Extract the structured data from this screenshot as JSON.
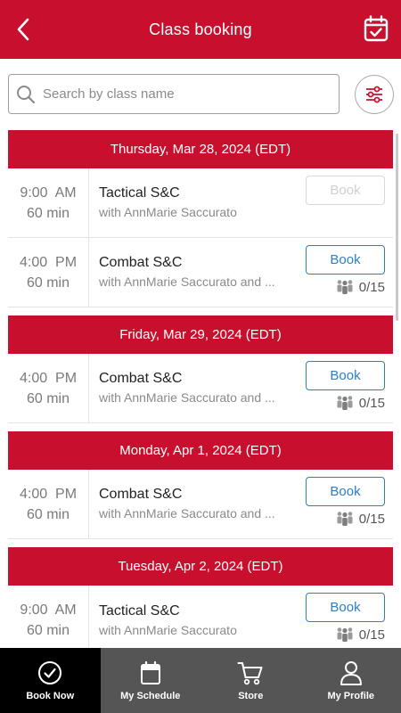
{
  "header": {
    "title": "Class booking"
  },
  "search": {
    "placeholder": "Search by class name"
  },
  "days": [
    {
      "date": "Thursday, Mar 28, 2024 (EDT)",
      "classes": [
        {
          "time": "9:00  AM",
          "duration": "60 min",
          "name": "Tactical S&C",
          "instructor": "with AnnMarie Saccurato",
          "book_label": "Book",
          "book_enabled": false,
          "capacity": ""
        },
        {
          "time": "4:00  PM",
          "duration": "60 min",
          "name": "Combat S&C",
          "instructor": "with AnnMarie Saccurato and ...",
          "book_label": "Book",
          "book_enabled": true,
          "capacity": "0/15"
        }
      ]
    },
    {
      "date": "Friday, Mar 29, 2024 (EDT)",
      "classes": [
        {
          "time": "4:00  PM",
          "duration": "60 min",
          "name": "Combat S&C",
          "instructor": "with AnnMarie Saccurato and ...",
          "book_label": "Book",
          "book_enabled": true,
          "capacity": "0/15"
        }
      ]
    },
    {
      "date": "Monday, Apr 1, 2024 (EDT)",
      "classes": [
        {
          "time": "4:00  PM",
          "duration": "60 min",
          "name": "Combat S&C",
          "instructor": "with AnnMarie Saccurato and ...",
          "book_label": "Book",
          "book_enabled": true,
          "capacity": "0/15"
        }
      ]
    },
    {
      "date": "Tuesday, Apr 2, 2024 (EDT)",
      "classes": [
        {
          "time": "9:00  AM",
          "duration": "60 min",
          "name": "Tactical S&C",
          "instructor": "with AnnMarie Saccurato",
          "book_label": "Book",
          "book_enabled": true,
          "capacity": "0/15"
        }
      ]
    }
  ],
  "tabs": [
    {
      "label": "Book Now",
      "icon": "check-circle-icon",
      "active": true
    },
    {
      "label": "My Schedule",
      "icon": "calendar-icon",
      "active": false
    },
    {
      "label": "Store",
      "icon": "cart-icon",
      "active": false
    },
    {
      "label": "My Profile",
      "icon": "user-icon",
      "active": false
    }
  ],
  "colors": {
    "brand": "#c8102e",
    "link": "#2a7fc7",
    "tabbar": "#555555",
    "tab_active": "#000000"
  }
}
